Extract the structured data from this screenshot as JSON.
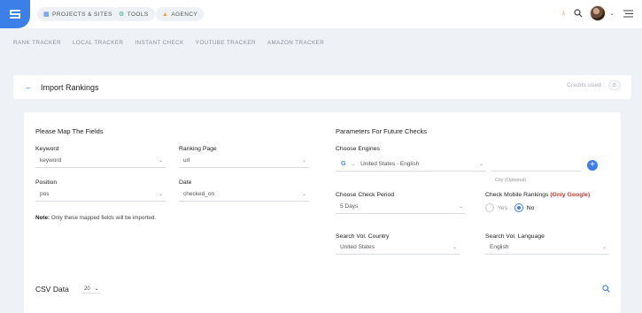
{
  "topnav": {
    "items": [
      {
        "label": "PROJECTS & SITES",
        "icon": "grid-icon"
      },
      {
        "label": "TOOLS",
        "icon": "tools-icon"
      },
      {
        "label": "AGENCY",
        "icon": "agency-icon"
      }
    ]
  },
  "subnav": [
    "RANK TRACKER",
    "LOCAL TRACKER",
    "INSTANT CHECK",
    "YOUTUBE TRACKER",
    "AMAZON TRACKER"
  ],
  "header": {
    "title": "Import Rankings",
    "credits_label": "Credits used :",
    "credits_value": "0"
  },
  "map_fields": {
    "title": "Please Map The Fields",
    "keyword_label": "Keyword",
    "keyword_value": "keyword",
    "ranking_page_label": "Ranking Page",
    "ranking_page_value": "url",
    "position_label": "Position",
    "position_value": "pos",
    "date_label": "Date",
    "date_value": "checked_on",
    "note_bold": "Note:",
    "note_text": "Only these mapped fields will be imported."
  },
  "future_checks": {
    "title": "Parameters For Future Checks",
    "engines_label": "Choose Engines",
    "engine_value": "United States - English",
    "city_placeholder": "City (Optional)",
    "period_label": "Choose Check Period",
    "period_value": "5 Days",
    "mobile_label": "Check Mobile Rankings",
    "mobile_label_suffix": "(Only Google)",
    "yes_label": "Yes",
    "no_label": "No",
    "country_label": "Search Vol. Country",
    "country_value": "United States",
    "language_label": "Search Vol. Language",
    "language_value": "English"
  },
  "csv": {
    "title": "CSV Data",
    "page_size": "20"
  },
  "colors": {
    "accent": "#3c7fe8",
    "notify": "#f0a030",
    "warning_red": "#c0392b"
  }
}
